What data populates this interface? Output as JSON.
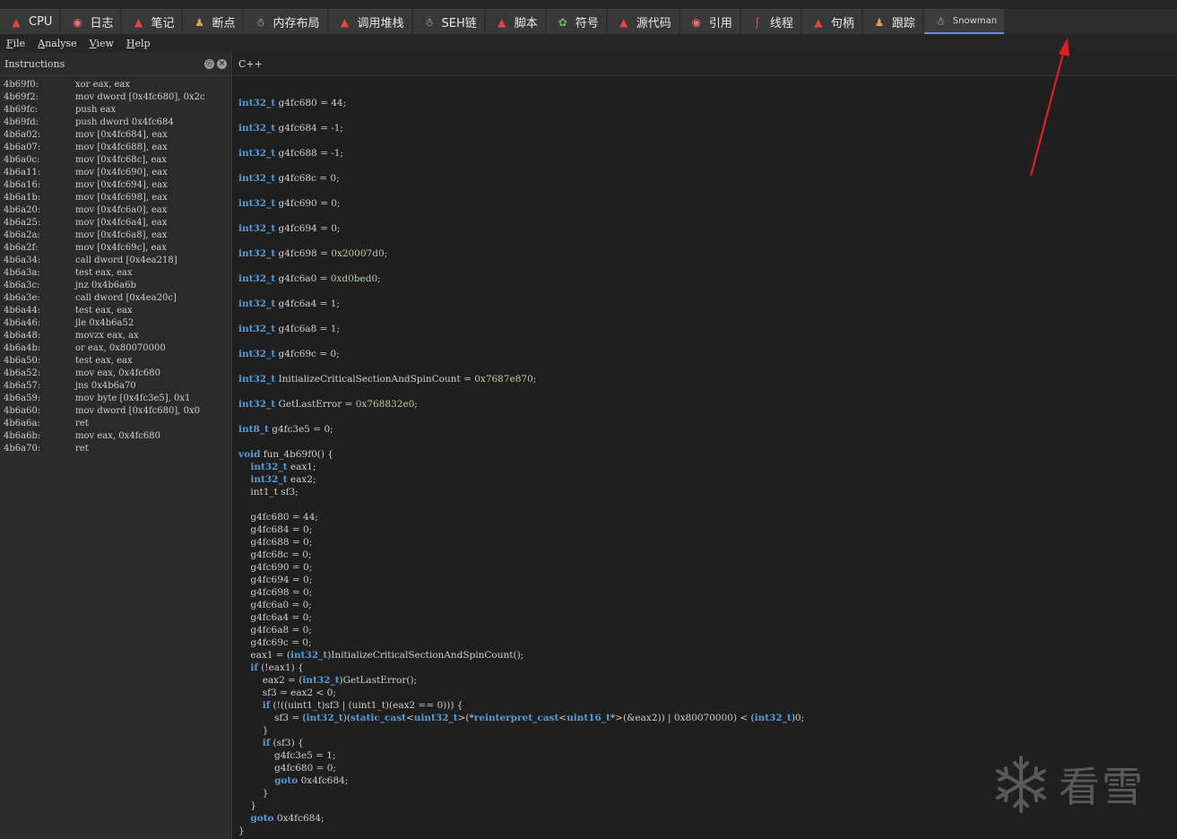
{
  "tabs": [
    {
      "label": "CPU",
      "icon": "santa-hat-icon"
    },
    {
      "label": "日志",
      "icon": "candy-icon"
    },
    {
      "label": "笔记",
      "icon": "santa-hat-icon"
    },
    {
      "label": "断点",
      "icon": "gingerbread-icon"
    },
    {
      "label": "内存布局",
      "icon": "snowman-icon"
    },
    {
      "label": "调用堆栈",
      "icon": "santa-hat-icon"
    },
    {
      "label": "SEH链",
      "icon": "snowman-icon"
    },
    {
      "label": "脚本",
      "icon": "santa-hat-icon"
    },
    {
      "label": "符号",
      "icon": "holly-icon"
    },
    {
      "label": "源代码",
      "icon": "santa-hat-icon"
    },
    {
      "label": "引用",
      "icon": "candy-icon"
    },
    {
      "label": "线程",
      "icon": "candy-cane-icon"
    },
    {
      "label": "句柄",
      "icon": "santa-hat-icon"
    },
    {
      "label": "跟踪",
      "icon": "gingerbread-icon"
    },
    {
      "label": "Snowman",
      "icon": "snowman-icon",
      "active": true
    }
  ],
  "menubar": {
    "items": [
      {
        "label": "File",
        "mnemonic": "F",
        "rest": "ile"
      },
      {
        "label": "Analyse",
        "mnemonic": "A",
        "rest": "nalyse"
      },
      {
        "label": "View",
        "mnemonic": "V",
        "rest": "iew"
      },
      {
        "label": "Help",
        "mnemonic": "H",
        "rest": "elp"
      }
    ]
  },
  "left_panel": {
    "title": "Instructions",
    "rows": [
      {
        "addr": "4b69f0:",
        "op": "xor eax, eax"
      },
      {
        "addr": "4b69f2:",
        "op": "mov dword [0x4fc680], 0x2c"
      },
      {
        "addr": "4b69fc:",
        "op": "push eax"
      },
      {
        "addr": "4b69fd:",
        "op": "push dword 0x4fc684"
      },
      {
        "addr": "4b6a02:",
        "op": "mov [0x4fc684], eax"
      },
      {
        "addr": "4b6a07:",
        "op": "mov [0x4fc688], eax"
      },
      {
        "addr": "4b6a0c:",
        "op": "mov [0x4fc68c], eax"
      },
      {
        "addr": "4b6a11:",
        "op": "mov [0x4fc690], eax"
      },
      {
        "addr": "4b6a16:",
        "op": "mov [0x4fc694], eax"
      },
      {
        "addr": "4b6a1b:",
        "op": "mov [0x4fc698], eax"
      },
      {
        "addr": "4b6a20:",
        "op": "mov [0x4fc6a0], eax"
      },
      {
        "addr": "4b6a25:",
        "op": "mov [0x4fc6a4], eax"
      },
      {
        "addr": "4b6a2a:",
        "op": "mov [0x4fc6a8], eax"
      },
      {
        "addr": "4b6a2f:",
        "op": "mov [0x4fc69c], eax"
      },
      {
        "addr": "4b6a34:",
        "op": "call dword [0x4ea218]"
      },
      {
        "addr": "4b6a3a:",
        "op": "test eax, eax"
      },
      {
        "addr": "4b6a3c:",
        "op": "jnz 0x4b6a6b"
      },
      {
        "addr": "4b6a3e:",
        "op": "call dword [0x4ea20c]"
      },
      {
        "addr": "4b6a44:",
        "op": "test eax, eax"
      },
      {
        "addr": "4b6a46:",
        "op": "jle 0x4b6a52"
      },
      {
        "addr": "4b6a48:",
        "op": "movzx eax, ax"
      },
      {
        "addr": "4b6a4b:",
        "op": "or eax, 0x80070000"
      },
      {
        "addr": "4b6a50:",
        "op": "test eax, eax"
      },
      {
        "addr": "4b6a52:",
        "op": "mov eax, 0x4fc680"
      },
      {
        "addr": "4b6a57:",
        "op": "jns 0x4b6a70"
      },
      {
        "addr": "4b6a59:",
        "op": "mov byte [0x4fc3e5], 0x1"
      },
      {
        "addr": "4b6a60:",
        "op": "mov dword [0x4fc680], 0x0"
      },
      {
        "addr": "4b6a6a:",
        "op": "ret"
      },
      {
        "addr": "4b6a6b:",
        "op": "mov eax, 0x4fc680"
      },
      {
        "addr": "4b6a70:",
        "op": "ret"
      }
    ]
  },
  "right_panel": {
    "title": "C++",
    "lines": [
      [],
      [
        {
          "t": "int32_t",
          "k": 1
        },
        {
          "t": " g4fc680 = 44;"
        }
      ],
      [],
      [
        {
          "t": "int32_t",
          "k": 1
        },
        {
          "t": " g4fc684 = -1;"
        }
      ],
      [],
      [
        {
          "t": "int32_t",
          "k": 1
        },
        {
          "t": " g4fc688 = -1;"
        }
      ],
      [],
      [
        {
          "t": "int32_t",
          "k": 1
        },
        {
          "t": " g4fc68c = 0;"
        }
      ],
      [],
      [
        {
          "t": "int32_t",
          "k": 1
        },
        {
          "t": " g4fc690 = 0;"
        }
      ],
      [],
      [
        {
          "t": "int32_t",
          "k": 1
        },
        {
          "t": " g4fc694 = 0;"
        }
      ],
      [],
      [
        {
          "t": "int32_t",
          "k": 1
        },
        {
          "t": " g4fc698 = "
        },
        {
          "t": "0x20007d0;",
          "n": 1
        }
      ],
      [],
      [
        {
          "t": "int32_t",
          "k": 1
        },
        {
          "t": " g4fc6a0 = "
        },
        {
          "t": "0xd0bed0;",
          "n": 1
        }
      ],
      [],
      [
        {
          "t": "int32_t",
          "k": 1
        },
        {
          "t": " g4fc6a4 = 1;"
        }
      ],
      [],
      [
        {
          "t": "int32_t",
          "k": 1
        },
        {
          "t": " g4fc6a8 = 1;"
        }
      ],
      [],
      [
        {
          "t": "int32_t",
          "k": 1
        },
        {
          "t": " g4fc69c = 0;"
        }
      ],
      [],
      [
        {
          "t": "int32_t",
          "k": 1
        },
        {
          "t": " InitializeCriticalSectionAndSpinCount = "
        },
        {
          "t": "0x7687e870;",
          "n": 1
        }
      ],
      [],
      [
        {
          "t": "int32_t",
          "k": 1
        },
        {
          "t": " GetLastError = "
        },
        {
          "t": "0x768832e0;",
          "n": 1
        }
      ],
      [],
      [
        {
          "t": "int8_t",
          "k": 1
        },
        {
          "t": " g4fc3e5 = 0;"
        }
      ],
      [],
      [
        {
          "t": "void",
          "k": 1
        },
        {
          "t": " fun_4b69f0() {"
        }
      ],
      [
        {
          "t": "    "
        },
        {
          "t": "int32_t",
          "k": 1
        },
        {
          "t": " eax1;"
        }
      ],
      [
        {
          "t": "    "
        },
        {
          "t": "int32_t",
          "k": 1
        },
        {
          "t": " eax2;"
        }
      ],
      [
        {
          "t": "    int1_t sf3;"
        }
      ],
      [],
      [
        {
          "t": "    g4fc680 = 44;"
        }
      ],
      [
        {
          "t": "    g4fc684 = 0;"
        }
      ],
      [
        {
          "t": "    g4fc688 = 0;"
        }
      ],
      [
        {
          "t": "    g4fc68c = 0;"
        }
      ],
      [
        {
          "t": "    g4fc690 = 0;"
        }
      ],
      [
        {
          "t": "    g4fc694 = 0;"
        }
      ],
      [
        {
          "t": "    g4fc698 = 0;"
        }
      ],
      [
        {
          "t": "    g4fc6a0 = 0;"
        }
      ],
      [
        {
          "t": "    g4fc6a4 = 0;"
        }
      ],
      [
        {
          "t": "    g4fc6a8 = 0;"
        }
      ],
      [
        {
          "t": "    g4fc69c = 0;"
        }
      ],
      [
        {
          "t": "    eax1 = ("
        },
        {
          "t": "int32_t",
          "k": 1
        },
        {
          "t": ")InitializeCriticalSectionAndSpinCount();"
        }
      ],
      [
        {
          "t": "    "
        },
        {
          "t": "if",
          "k": 1
        },
        {
          "t": " (!eax1) {"
        }
      ],
      [
        {
          "t": "        eax2 = ("
        },
        {
          "t": "int32_t",
          "k": 1
        },
        {
          "t": ")GetLastError();"
        }
      ],
      [
        {
          "t": "        sf3 = eax2 < 0;"
        }
      ],
      [
        {
          "t": "        "
        },
        {
          "t": "if",
          "k": 1
        },
        {
          "t": " (!((uint1_t)sf3 | (uint1_t)(eax2 == 0))) {"
        }
      ],
      [
        {
          "t": "            sf3 = ("
        },
        {
          "t": "int32_t",
          "k": 1
        },
        {
          "t": ")("
        },
        {
          "t": "static_cast",
          "k": 1
        },
        {
          "t": "<"
        },
        {
          "t": "uint32_t",
          "k": 1
        },
        {
          "t": ">(*"
        },
        {
          "t": "reinterpret_cast",
          "k": 1
        },
        {
          "t": "<"
        },
        {
          "t": "uint16_t",
          "k": 1
        },
        {
          "t": "*>(&eax2)) | 0x80070000) < ("
        },
        {
          "t": "int32_t",
          "k": 1
        },
        {
          "t": ")0;"
        }
      ],
      [
        {
          "t": "        }"
        }
      ],
      [
        {
          "t": "        "
        },
        {
          "t": "if",
          "k": 1
        },
        {
          "t": " (sf3) {"
        }
      ],
      [
        {
          "t": "            g4fc3e5 = 1;"
        }
      ],
      [
        {
          "t": "            g4fc680 = 0;"
        }
      ],
      [
        {
          "t": "            "
        },
        {
          "t": "goto",
          "k": 1
        },
        {
          "t": " 0x4fc684;"
        }
      ],
      [
        {
          "t": "        }"
        }
      ],
      [
        {
          "t": "    }"
        }
      ],
      [
        {
          "t": "    "
        },
        {
          "t": "goto",
          "k": 1
        },
        {
          "t": " 0x4fc684;"
        }
      ],
      [
        {
          "t": "}"
        }
      ]
    ]
  },
  "watermark": {
    "text": "看雪",
    "icon": "snowflake-icon"
  },
  "colors": {
    "keyword": "#569cd6",
    "number": "#b5cea8",
    "arrow": "#e02020",
    "active_tab_underline": "#6a8fd6"
  }
}
